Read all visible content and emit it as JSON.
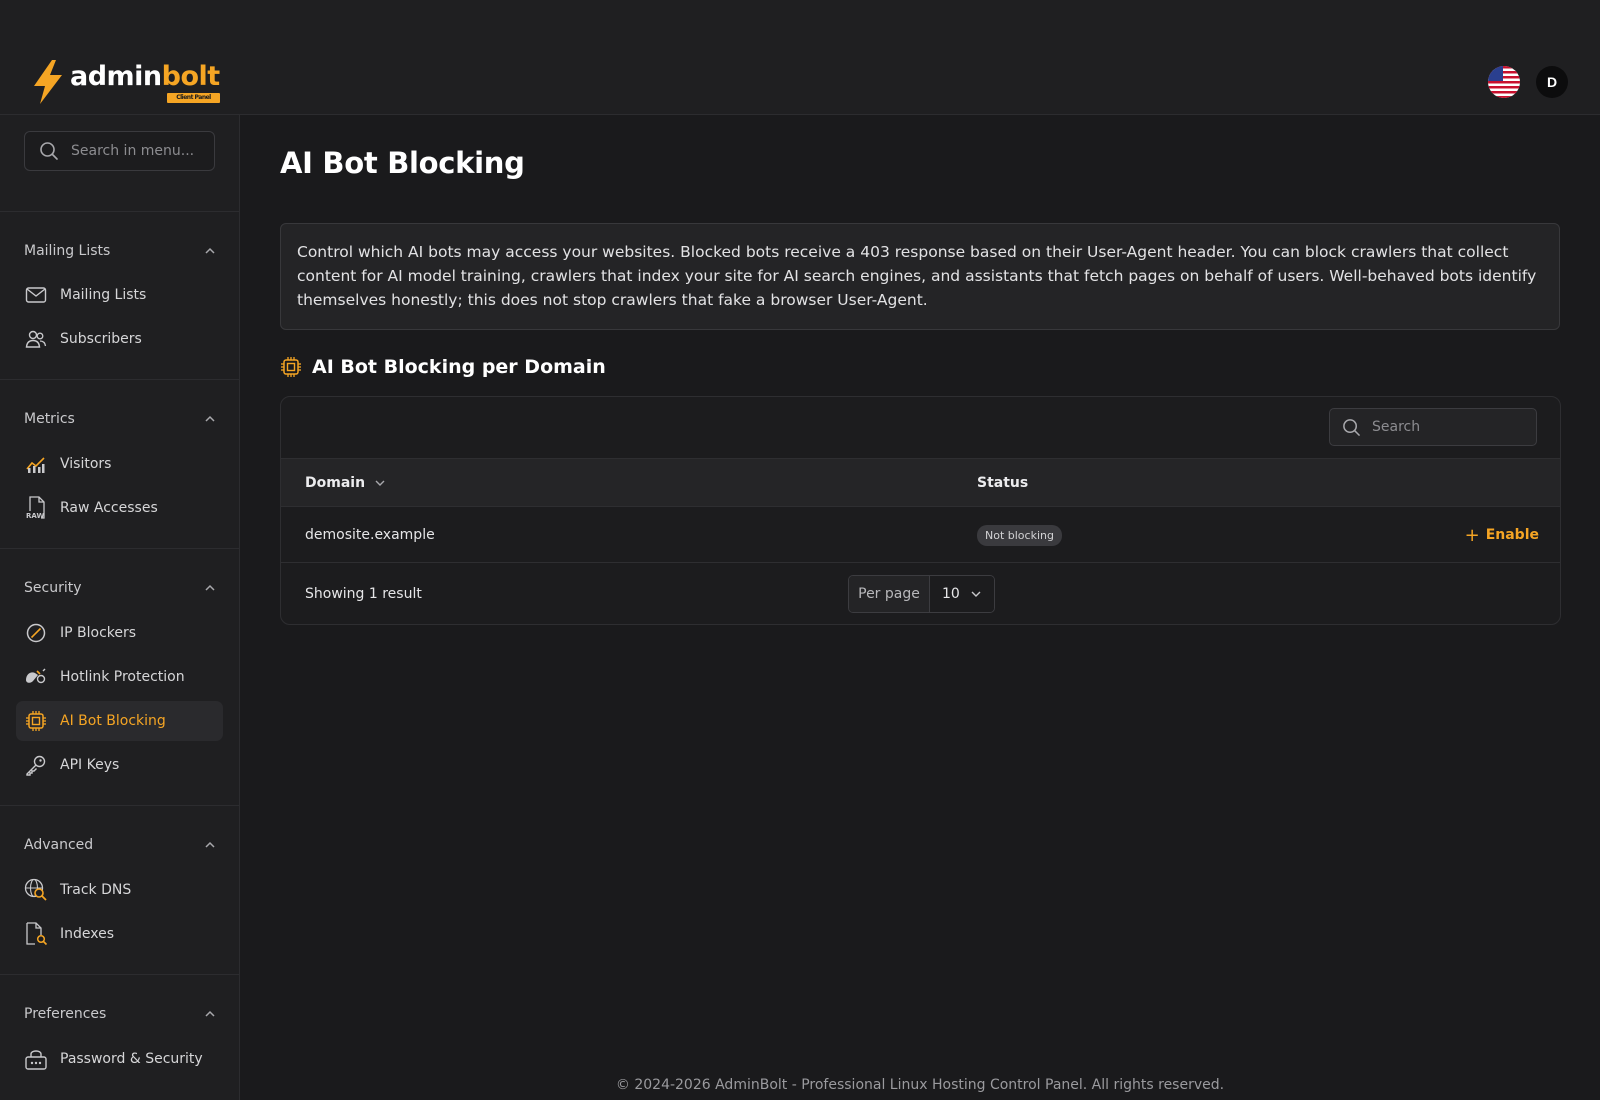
{
  "brand": {
    "name_part1": "admin",
    "name_part2": "bolt",
    "badge": "Client Panel"
  },
  "header": {
    "language_flag": "us-flag-icon",
    "avatar_initial": "D"
  },
  "sidebar": {
    "search_placeholder": "Search in menu...",
    "groups": [
      {
        "title": "Mailing Lists",
        "items": [
          {
            "label": "Mailing Lists",
            "icon": "mail-icon"
          },
          {
            "label": "Subscribers",
            "icon": "users-icon"
          }
        ]
      },
      {
        "title": "Metrics",
        "items": [
          {
            "label": "Visitors",
            "icon": "chart-icon"
          },
          {
            "label": "Raw Accesses",
            "icon": "raw-file-icon"
          }
        ]
      },
      {
        "title": "Security",
        "items": [
          {
            "label": "IP Blockers",
            "icon": "block-icon"
          },
          {
            "label": "Hotlink Protection",
            "icon": "hotlink-icon"
          },
          {
            "label": "AI Bot Blocking",
            "icon": "chip-icon",
            "active": true
          },
          {
            "label": "API Keys",
            "icon": "key-icon"
          }
        ]
      },
      {
        "title": "Advanced",
        "items": [
          {
            "label": "Track DNS",
            "icon": "dns-search-icon"
          },
          {
            "label": "Indexes",
            "icon": "file-search-icon"
          }
        ]
      },
      {
        "title": "Preferences",
        "items": [
          {
            "label": "Password & Security",
            "icon": "lock-icon"
          }
        ]
      }
    ]
  },
  "main": {
    "title": "AI Bot Blocking",
    "description": "Control which AI bots may access your websites. Blocked bots receive a 403 response based on their User-Agent header. You can block crawlers that collect content for AI model training, crawlers that index your site for AI search engines, and assistants that fetch pages on behalf of users. Well-behaved bots identify themselves honestly; this does not stop crawlers that fake a browser User-Agent.",
    "section_title": "AI Bot Blocking per Domain",
    "table": {
      "search_placeholder": "Search",
      "columns": [
        "Domain",
        "Status"
      ],
      "rows": [
        {
          "domain": "demosite.example",
          "status": "Not blocking",
          "action": "Enable"
        }
      ],
      "showing": "Showing 1 result",
      "per_page_label": "Per page",
      "per_page_value": "10"
    }
  },
  "footer": {
    "text": "© 2024-2026 AdminBolt - Professional Linux Hosting Control Panel. All rights reserved."
  },
  "colors": {
    "accent": "#f5a524",
    "background": "#1a1a1c",
    "panel": "#1f1f21"
  }
}
